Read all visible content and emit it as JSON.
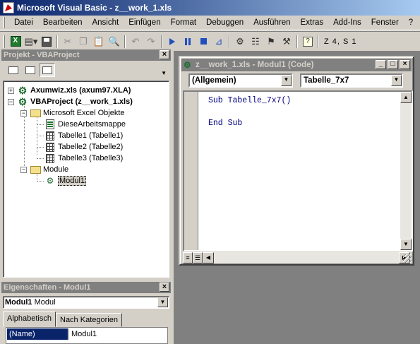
{
  "window": {
    "title": "Microsoft Visual Basic - z__work_1.xls"
  },
  "menu": {
    "items": [
      "Datei",
      "Bearbeiten",
      "Ansicht",
      "Einfügen",
      "Format",
      "Debuggen",
      "Ausführen",
      "Extras",
      "Add-Ins",
      "Fenster",
      "?"
    ]
  },
  "toolbar": {
    "position": "Z 4, S 1"
  },
  "project": {
    "title": "Projekt - VBAProject",
    "close": "×",
    "nodes": {
      "axumwiz": "Axumwiz.xls (axum97.XLA)",
      "vbaproject": "VBAProject (z__work_1.xls)",
      "excel_objects": "Microsoft Excel Objekte",
      "diese": "DieseArbeitsmappe",
      "t1": "Tabelle1 (Tabelle1)",
      "t2": "Tabelle2 (Tabelle2)",
      "t3": "Tabelle3 (Tabelle3)",
      "module": "Module",
      "modul1": "Modul1"
    }
  },
  "properties": {
    "title": "Eigenschaften - Modul1",
    "close": "×",
    "object_name": "Modul1",
    "object_type": "Modul",
    "tabs": [
      "Alphabetisch",
      "Nach Kategorien"
    ],
    "rows": [
      {
        "name": "(Name)",
        "value": "Modul1"
      }
    ]
  },
  "code": {
    "title": "z__work_1.xls - Modul1 (Code)",
    "object_combo": "(Allgemein)",
    "proc_combo": "Tabelle_7x7",
    "lines": [
      "Sub Tabelle_7x7()",
      "End Sub"
    ]
  }
}
